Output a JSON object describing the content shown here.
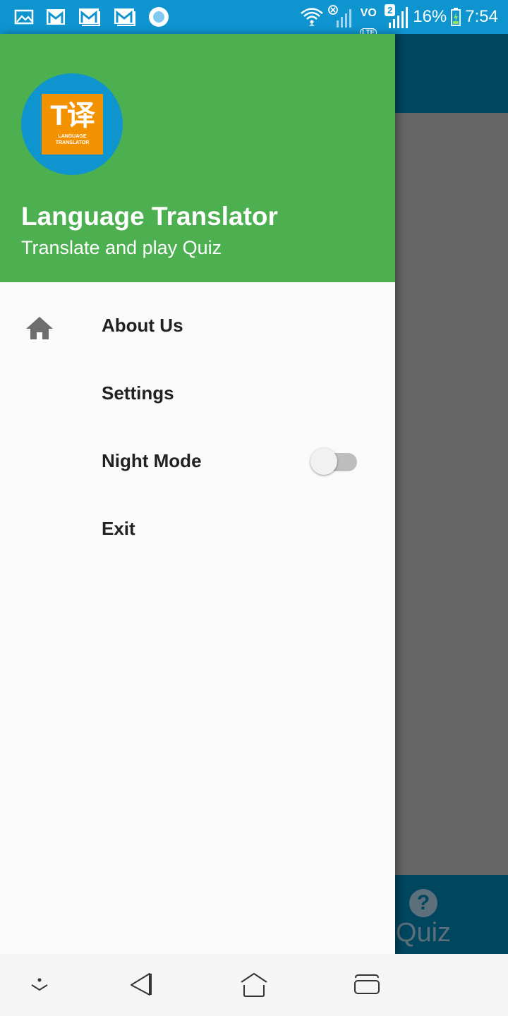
{
  "status_bar": {
    "battery_percent": "16%",
    "time": "7:54",
    "notification_badge": "2",
    "volte_label": "VO",
    "lte_label": "LTE",
    "icons": [
      "image-icon",
      "gmail-icon",
      "gmail-icon",
      "gmail-icon",
      "record-icon",
      "wifi-icon",
      "signal-off-icon",
      "volte-icon",
      "signal-icon",
      "battery-charging-icon"
    ]
  },
  "drawer": {
    "logo_big_text": "T译",
    "logo_line1": "LANGUAGE",
    "logo_line2": "TRANSLATOR",
    "title": "Language Translator",
    "subtitle": "Translate and play Quiz",
    "items": [
      {
        "label": "About Us",
        "icon": "home-icon"
      },
      {
        "label": "Settings"
      },
      {
        "label": "Night Mode",
        "toggle_on": false
      },
      {
        "label": "Exit"
      }
    ]
  },
  "background_app": {
    "bottom_tab_label": "Quiz",
    "bottom_tab_icon_glyph": "?"
  },
  "colors": {
    "status_bar": "#0e94cf",
    "drawer_header": "#4caf50",
    "app_toolbar": "#00465f",
    "logo_orange": "#f39200"
  }
}
